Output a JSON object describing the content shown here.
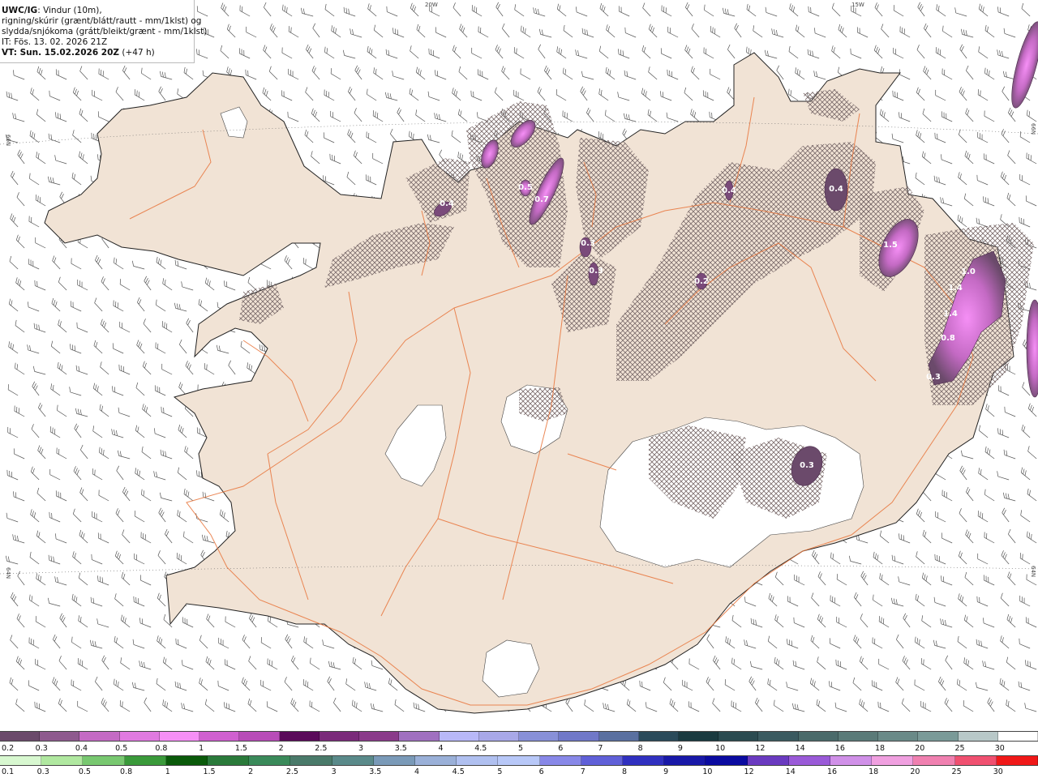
{
  "header": {
    "product": "UWC/IG",
    "line1_rest": ": Vindur (10m),",
    "line2": "rigning/skúrir (grænt/blátt/rautt - mm/1klst) og",
    "line3": "slydda/snjókoma (grátt/bleikt/grænt - mm/1klst)",
    "line4": "IT: Fös. 13. 02. 2026 21Z",
    "line5_bold": "VT: Sun. 15.02.2026 20Z",
    "line5_rest": " (+47 h)"
  },
  "graticule": {
    "lon_20w": "20W",
    "lon_15w": "15W",
    "lat_left_66": "66N",
    "lat_left_64": "64N",
    "lat_right_66": "66N",
    "lat_right_64": "64N"
  },
  "precip_labels": [
    {
      "value": "0.4",
      "color": "#ffffff"
    },
    {
      "value": "0.4",
      "color": "#ffffff"
    },
    {
      "value": "0.5",
      "color": "#ffffff"
    },
    {
      "value": "0.7",
      "color": "#ffffff"
    },
    {
      "value": "0.3",
      "color": "#ffffff"
    },
    {
      "value": "0.3",
      "color": "#ffffff"
    },
    {
      "value": "0.2",
      "color": "#ffffff"
    },
    {
      "value": "0.4",
      "color": "#ffffff"
    },
    {
      "value": "1.5",
      "color": "#ffffff"
    },
    {
      "value": "1.0",
      "color": "#ffffff"
    },
    {
      "value": "1.4",
      "color": "#ffffff"
    },
    {
      "value": "1.4",
      "color": "#ffffff"
    },
    {
      "value": "0.8",
      "color": "#ffffff"
    },
    {
      "value": "0.3",
      "color": "#ffffff"
    },
    {
      "value": "0.3",
      "color": "#ffffff"
    }
  ],
  "snow_scale": {
    "labels": [
      "0.2",
      "0.3",
      "0.4",
      "0.5",
      "0.8",
      "1",
      "1.5",
      "2",
      "2.5",
      "3",
      "3.5",
      "4",
      "4.5",
      "5",
      "6",
      "7",
      "8",
      "9",
      "10",
      "12",
      "14",
      "16",
      "18",
      "20",
      "25",
      "30"
    ],
    "colors": [
      "#6b4a6b",
      "#8e5a8e",
      "#c46ac4",
      "#e07ae0",
      "#f58ff5",
      "#d060d0",
      "#b84cb8",
      "#5a0a5a",
      "#7a2a7a",
      "#8a3a8a",
      "#a070c0",
      "#b8b8f8",
      "#a8a8e8",
      "#8890d8",
      "#7078c8",
      "#5a70a0",
      "#2a4a5a",
      "#1a3a40",
      "#2a4a50",
      "#3a5a60",
      "#4a6a6a",
      "#5a7a78",
      "#6a8a88",
      "#7a9a98",
      "#b8c8c8",
      "#ffffff"
    ]
  },
  "rain_scale": {
    "labels": [
      "0.1",
      "0.3",
      "0.5",
      "0.8",
      "1",
      "1.5",
      "2",
      "2.5",
      "3",
      "3.5",
      "4",
      "4.5",
      "5",
      "6",
      "7",
      "8",
      "9",
      "10",
      "12",
      "14",
      "16",
      "18",
      "20",
      "25",
      "30"
    ],
    "colors": [
      "#d8f8d0",
      "#b0e8a0",
      "#78c870",
      "#3a9a3a",
      "#0a5a0a",
      "#2a7a3a",
      "#3a8a5a",
      "#4a7a6a",
      "#5a8a8a",
      "#7a9ab8",
      "#9ab0d8",
      "#b0c0f0",
      "#b8c8f8",
      "#8888e8",
      "#6060d8",
      "#3030c0",
      "#1818a8",
      "#0a0aa0",
      "#6a3ac0",
      "#9a5ad8",
      "#d090e8",
      "#f0a0e0",
      "#f080b0",
      "#f05070",
      "#f01818"
    ]
  },
  "colors": {
    "land": "#f1e3d5",
    "glacier": "#ffffff",
    "sea": "#ffffff",
    "roads": "#e8743a",
    "coast": "#222222",
    "barb": "#555555",
    "snow_hatch": "#7a6a6a"
  }
}
